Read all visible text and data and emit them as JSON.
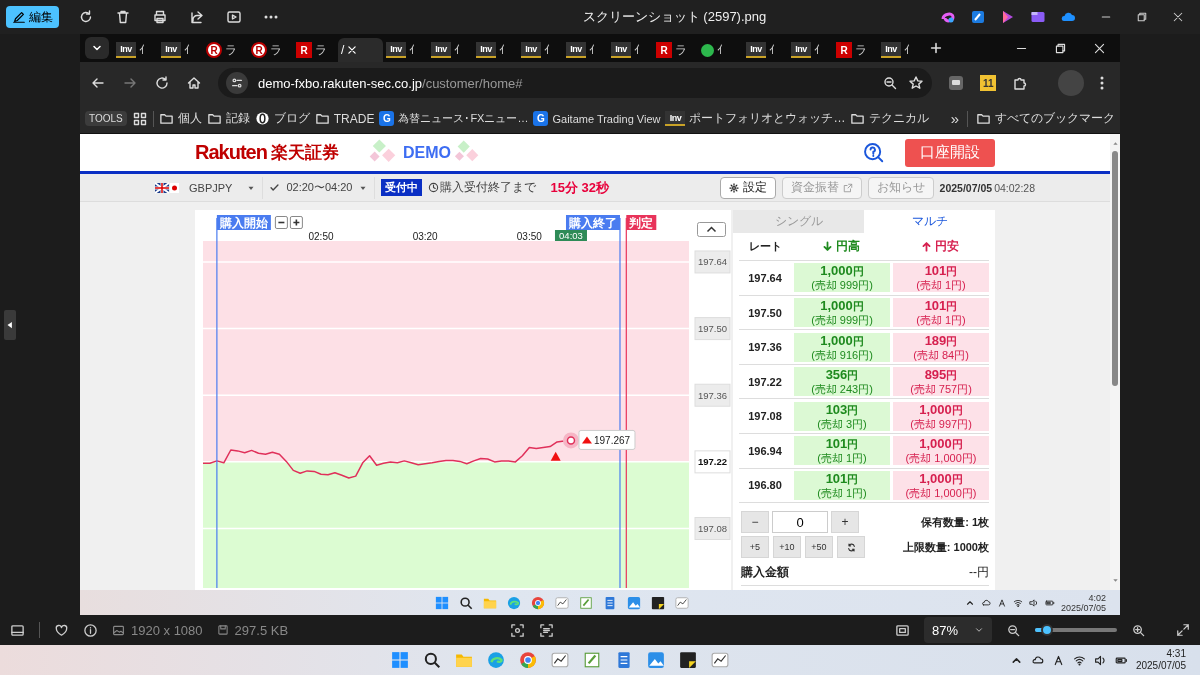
{
  "app_bar": {
    "edit_button": "編集",
    "title": "スクリーンショット (2597).png"
  },
  "browser": {
    "tabs": [
      {
        "kind": "inv",
        "favicon_text": "Inv",
        "title": "ｲ",
        "selected": false
      },
      {
        "kind": "inv",
        "favicon_text": "Inv",
        "title": "ｲ",
        "selected": false
      },
      {
        "kind": "r-circle",
        "favicon_text": "R",
        "title": "ラ",
        "selected": false
      },
      {
        "kind": "r-circle",
        "favicon_text": "R",
        "title": "ラ",
        "selected": false
      },
      {
        "kind": "r-square",
        "favicon_text": "R",
        "title": "ラ",
        "selected": false
      },
      {
        "kind": "plain",
        "title": "/",
        "selected": true
      },
      {
        "kind": "inv",
        "favicon_text": "Inv",
        "title": "ｲ",
        "selected": false
      },
      {
        "kind": "inv",
        "favicon_text": "Inv",
        "title": "ｲ",
        "selected": false
      },
      {
        "kind": "inv",
        "favicon_text": "Inv",
        "title": "ｲ",
        "selected": false
      },
      {
        "kind": "inv",
        "favicon_text": "Inv",
        "title": "ｲ",
        "selected": false
      },
      {
        "kind": "inv",
        "favicon_text": "Inv",
        "title": "ｲ",
        "selected": false
      },
      {
        "kind": "inv",
        "favicon_text": "Inv",
        "title": "ｲ",
        "selected": false
      },
      {
        "kind": "r-square",
        "favicon_text": "R",
        "title": "ラ",
        "selected": false
      },
      {
        "kind": "green",
        "title": "ｲ",
        "selected": false
      },
      {
        "kind": "inv",
        "favicon_text": "Inv",
        "title": "ｲ",
        "selected": false
      },
      {
        "kind": "inv",
        "favicon_text": "Inv",
        "title": "ｲ",
        "selected": false
      },
      {
        "kind": "r-square",
        "favicon_text": "R",
        "title": "ラ",
        "selected": false
      },
      {
        "kind": "inv",
        "favicon_text": "Inv",
        "title": "ｲ",
        "selected": false
      }
    ],
    "address": {
      "host": "demo-fxbo.rakuten-sec.co.jp",
      "path": "/customer/home#"
    },
    "extension_badge": "11",
    "bookmarks": [
      {
        "kind": "button",
        "label": "TOOLS"
      },
      {
        "kind": "apps"
      },
      {
        "kind": "folder",
        "label": "個人"
      },
      {
        "kind": "folder",
        "label": "記録"
      },
      {
        "kind": "ring-site",
        "label": "ブログ"
      },
      {
        "kind": "folder",
        "label": "TRADE"
      },
      {
        "kind": "g-site",
        "logo_text": "G",
        "label": "為替ニュース･FXニュー…"
      },
      {
        "kind": "g-site",
        "logo_text": "G",
        "label": "Gaitame Trading View"
      },
      {
        "kind": "inv-site",
        "logo_text": "Inv",
        "label": "ポートフォリオとウォッチ…"
      },
      {
        "kind": "folder",
        "label": "テクニカル"
      }
    ],
    "overflow": "»",
    "all_bookmarks": "すべてのブックマーク"
  },
  "page": {
    "logo": {
      "brand": "Rakuten",
      "name": "楽天証券",
      "badge": "DEMO"
    },
    "open_account": "口座開設",
    "toolbar": {
      "pair": "GBPJPY",
      "period": "02:20〜04:20",
      "status": "受付中",
      "countdown_label": "購入受付終了まで",
      "countdown": "15分 32秒",
      "buttons": [
        {
          "label": "設定",
          "kind": "settings",
          "disabled": false
        },
        {
          "label": "資金振替",
          "kind": "external",
          "disabled": true
        },
        {
          "label": "お知らせ",
          "kind": "plain",
          "disabled": true
        }
      ],
      "date": "2025/07/05",
      "time": "04:02:28"
    },
    "chart": {
      "markers": [
        {
          "kind": "start",
          "label": "購入開始"
        },
        {
          "kind": "end",
          "label": "購入終了"
        },
        {
          "kind": "judge",
          "label": "判定"
        }
      ],
      "current_time": "04:03",
      "current_price": "197.267",
      "entry_marker": true,
      "chart_data": {
        "type": "line",
        "grid": true,
        "categories": [
          null,
          null,
          null,
          null,
          null,
          null,
          null,
          null,
          null,
          null,
          null,
          null,
          null,
          null,
          null,
          null,
          null,
          "02:50",
          null,
          null,
          null,
          null,
          null,
          null,
          null,
          null,
          null,
          null,
          null,
          null,
          null,
          null,
          "03:20",
          null,
          null,
          null,
          null,
          null,
          null,
          null,
          null,
          null,
          null,
          null,
          null,
          null,
          null,
          "03:50",
          null,
          null,
          null,
          null,
          null,
          null,
          null,
          null,
          null,
          null,
          null,
          null,
          null,
          null,
          null,
          null,
          null,
          null,
          null,
          null,
          null,
          null,
          null
        ],
        "values": [
          197.217,
          197.217,
          197.222,
          197.218,
          197.245,
          197.243,
          197.239,
          197.244,
          197.238,
          197.236,
          197.24,
          197.236,
          197.221,
          197.202,
          197.196,
          197.201,
          197.2,
          197.194,
          197.193,
          197.197,
          197.192,
          197.186,
          197.19,
          197.218,
          197.233,
          197.213,
          197.217,
          197.22,
          197.218,
          197.222,
          197.218,
          197.214,
          197.216,
          197.218,
          197.221,
          197.223,
          197.223,
          197.221,
          197.216,
          197.222,
          197.227,
          197.226,
          197.22,
          197.222,
          197.222,
          197.22,
          197.233,
          197.25,
          197.248,
          197.25,
          197.252,
          197.262,
          197.264,
          197.265,
          null,
          null,
          null,
          null,
          null,
          null,
          null,
          null,
          null,
          null,
          null,
          null,
          null,
          null,
          null,
          null,
          null
        ],
        "ylim": [
          196.955,
          197.684
        ],
        "yticks": [
          {
            "value": 197.08,
            "label": "197.08"
          },
          {
            "value": 197.22,
            "label": "197.22"
          },
          {
            "value": 197.36,
            "label": "197.36"
          },
          {
            "value": 197.5,
            "label": "197.50"
          },
          {
            "value": 197.64,
            "label": "197.64"
          }
        ]
      }
    },
    "order": {
      "tabs": [
        {
          "label": "シングル",
          "selected": false
        },
        {
          "label": "マルチ",
          "selected": true
        }
      ],
      "columns": [
        {
          "label": "レート",
          "kind": "rate"
        },
        {
          "label": "円高",
          "kind": "down"
        },
        {
          "label": "円安",
          "kind": "up"
        }
      ],
      "rows": [
        {
          "rate": "197.64",
          "high": {
            "price": "1,000",
            "unit": "円",
            "sell": "(売却 999円)"
          },
          "low": {
            "price": "101",
            "unit": "円",
            "sell": "(売却 1円)"
          }
        },
        {
          "rate": "197.50",
          "high": {
            "price": "1,000",
            "unit": "円",
            "sell": "(売却 999円)"
          },
          "low": {
            "price": "101",
            "unit": "円",
            "sell": "(売却 1円)"
          }
        },
        {
          "rate": "197.36",
          "high": {
            "price": "1,000",
            "unit": "円",
            "sell": "(売却 916円)"
          },
          "low": {
            "price": "189",
            "unit": "円",
            "sell": "(売却 84円)"
          }
        },
        {
          "rate": "197.22",
          "high": {
            "price": "356",
            "unit": "円",
            "sell": "(売却 243円)"
          },
          "low": {
            "price": "895",
            "unit": "円",
            "sell": "(売却 757円)"
          }
        },
        {
          "rate": "197.08",
          "high": {
            "price": "103",
            "unit": "円",
            "sell": "(売却 3円)"
          },
          "low": {
            "price": "1,000",
            "unit": "円",
            "sell": "(売却 997円)"
          }
        },
        {
          "rate": "196.94",
          "high": {
            "price": "101",
            "unit": "円",
            "sell": "(売却 1円)"
          },
          "low": {
            "price": "1,000",
            "unit": "円",
            "sell": "(売却 1,000円)"
          }
        },
        {
          "rate": "196.80",
          "high": {
            "price": "101",
            "unit": "円",
            "sell": "(売却 1円)"
          },
          "low": {
            "price": "1,000",
            "unit": "円",
            "sell": "(売却 1,000円)"
          }
        }
      ],
      "minus_button": "−",
      "quantity": "0",
      "plus_button": "+",
      "step_buttons": [
        "+5",
        "+10",
        "+50"
      ],
      "held": "保有数量: 1枚",
      "limit": "上限数量: 1000枚",
      "amount_label": "購入金額",
      "amount": "--円"
    }
  },
  "inner_taskbar": {
    "time": "4:02",
    "date": "2025/07/05"
  },
  "info_bar": {
    "dimensions": "1920 x 1080",
    "size": "297.5 KB",
    "zoom": "87%",
    "zoom_slider": {
      "level": 0.15
    }
  },
  "taskbar": {
    "time": "4:31",
    "date": "2025/07/05"
  }
}
